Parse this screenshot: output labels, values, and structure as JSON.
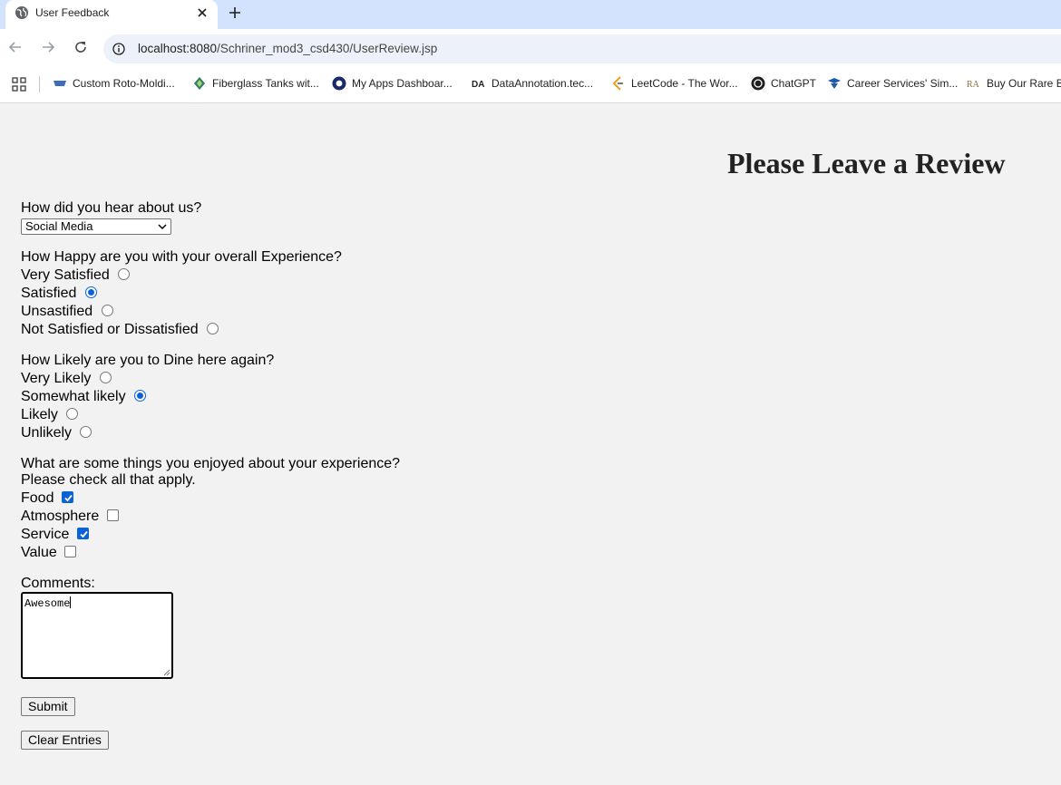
{
  "browser": {
    "tab_title": "User Feedback",
    "url_host": "localhost:8080",
    "url_path": "/Schriner_mod3_csd430/UserReview.jsp",
    "bookmarks": [
      {
        "label": "Custom Roto-Moldi...",
        "icon": "rotomold-icon"
      },
      {
        "label": "Fiberglass Tanks wit...",
        "icon": "fiberglass-icon"
      },
      {
        "label": "My Apps Dashboar...",
        "icon": "okta-icon"
      },
      {
        "label": "DataAnnotation.tec...",
        "icon": "dataannotation-icon"
      },
      {
        "label": "LeetCode - The Wor...",
        "icon": "leetcode-icon"
      },
      {
        "label": "ChatGPT",
        "icon": "chatgpt-icon"
      },
      {
        "label": "Career Services' Sim...",
        "icon": "career-icon"
      },
      {
        "label": "Buy Our Rare B",
        "icon": "rare-icon"
      }
    ]
  },
  "form": {
    "heading": "Please Leave a Review",
    "hear": {
      "question": "How did you hear about us?",
      "selected": "Social Media"
    },
    "happy": {
      "question": "How Happy are you with your overall Experience?",
      "options": [
        "Very Satisfied",
        "Satisfied",
        "Unsastified",
        "Not Satisfied or Dissatisfied"
      ],
      "selected_index": 1
    },
    "likely": {
      "question": "How Likely are you to Dine here again?",
      "options": [
        "Very Likely",
        "Somewhat likely",
        "Likely",
        "Unlikely"
      ],
      "selected_index": 1
    },
    "enjoyed": {
      "question": "What are some things you enjoyed about your experience?",
      "hint": "Please check all that apply.",
      "options": [
        "Food",
        "Atmosphere",
        "Service",
        "Value"
      ],
      "checked": [
        true,
        false,
        true,
        false
      ]
    },
    "comments": {
      "label": "Comments:",
      "value": "Awesome"
    },
    "submit_label": "Submit",
    "clear_label": "Clear Entries"
  },
  "colors": {
    "accent": "#0b62d6",
    "tabstrip": "#d3e3fd",
    "page_bg": "#f2f2f2"
  }
}
